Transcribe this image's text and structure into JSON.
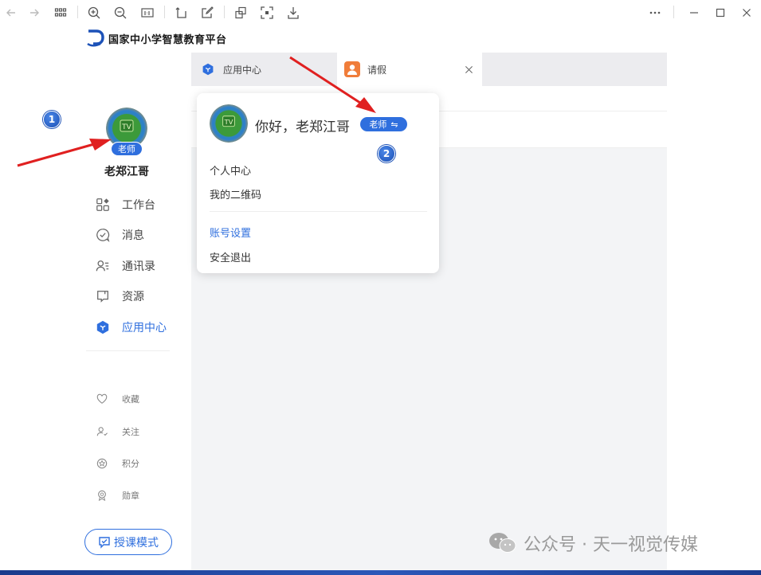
{
  "app": {
    "logo_text": "国家中小学智慧教育平台"
  },
  "user": {
    "name": "老郑江哥",
    "role_badge": "老师",
    "avatar_text": "TV"
  },
  "nav": {
    "items": [
      {
        "label": "工作台",
        "icon": "workbench-icon"
      },
      {
        "label": "消息",
        "icon": "message-icon"
      },
      {
        "label": "通讯录",
        "icon": "contacts-icon"
      },
      {
        "label": "资源",
        "icon": "resource-icon"
      },
      {
        "label": "应用中心",
        "icon": "app-center-icon",
        "active": true
      }
    ],
    "sub_items": [
      {
        "label": "收藏",
        "icon": "heart-icon"
      },
      {
        "label": "关注",
        "icon": "follow-icon"
      },
      {
        "label": "积分",
        "icon": "points-icon"
      },
      {
        "label": "勋章",
        "icon": "medal-icon"
      }
    ],
    "lecture_mode": "授课模式"
  },
  "tabs": [
    {
      "label": "应用中心",
      "icon": "app-center-icon"
    },
    {
      "label": "请假",
      "icon": "leave-icon",
      "active": true
    }
  ],
  "popup": {
    "greeting": "你好，老郑江哥",
    "role_badge": "老师",
    "switch_glyph": "⇋",
    "items": [
      "个人中心",
      "我的二维码"
    ],
    "settings": "账号设置",
    "logout": "安全退出"
  },
  "annotations": {
    "marker1": "1",
    "marker2": "2"
  },
  "watermark": "公众号 · 天一视觉传媒",
  "colors": {
    "accent": "#2f6fde",
    "arrow": "#e02020",
    "leave_tab_icon": "#f07d3a"
  }
}
